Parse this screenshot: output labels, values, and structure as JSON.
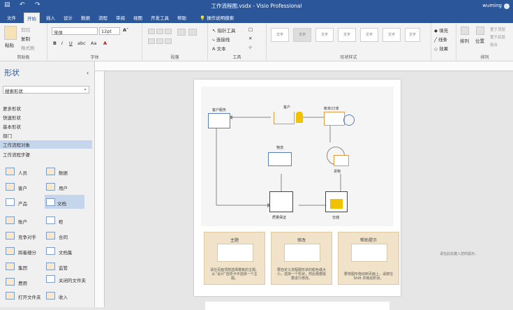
{
  "titlebar": {
    "title": "工作流程图.vsdx - Visio Professional",
    "user": "wuming"
  },
  "tabs": [
    "文件",
    "开始",
    "插入",
    "设计",
    "数据",
    "流程",
    "审阅",
    "视图",
    "开发工具",
    "帮助",
    "操作说明搜索"
  ],
  "ribbon": {
    "clipboard": {
      "paste": "粘贴",
      "cut": "剪切",
      "copy": "复制",
      "painter": "格式刷",
      "label": "剪贴板"
    },
    "font": {
      "family": "宋体",
      "size": "12pt",
      "label": "字体"
    },
    "paragraph": {
      "label": "段落"
    },
    "tools": {
      "pointer": "指针工具",
      "connector": "连接线",
      "text": "文本",
      "label": "工具"
    },
    "styles": {
      "sample": "文字",
      "label": "形状样式"
    },
    "shape_fill": {
      "fill": "填充",
      "line": "线条",
      "effects": "效果"
    },
    "arrange": {
      "arrange": "排列",
      "position": "位置",
      "front": "置于顶层",
      "back": "置于底层",
      "group": "组合",
      "label": "排列"
    }
  },
  "sidebar": {
    "title": "形状",
    "search_placeholder": "搜索形状",
    "items": [
      "更多形状",
      "快速形状",
      "基本形状",
      "部门",
      "工作流程对象",
      "工作流程步骤"
    ],
    "selected": "工作流程对象",
    "shapes": [
      [
        "人员",
        "数据"
      ],
      [
        "客户",
        "用户"
      ],
      [
        "产品",
        "文档"
      ],
      [
        "账户",
        "柜"
      ],
      [
        "竞争对手",
        "合同"
      ],
      [
        "跨着细分",
        "文档集"
      ],
      [
        "集团",
        "监管"
      ],
      [
        "费用",
        "关闭的文件夹"
      ],
      [
        "打开文件夹",
        "收入"
      ]
    ]
  },
  "diagram": {
    "nodes": [
      "客户服务",
      "客户",
      "帐单/订单",
      "物流",
      "货物",
      "质量保证",
      "仓储"
    ],
    "cards": [
      {
        "title": "主题",
        "desc": "请在页面顶部选择模板的主题。从“设计”选项卡中选择一个主题。"
      },
      {
        "title": "修改",
        "desc": "要自定义流程图形状的颜色或大小，选择一个形状，然后根据需要进行修改。"
      },
      {
        "title": "帮助提示",
        "desc": "要将图形拖动到页面上，请按住 Shift 并拖动形状。"
      }
    ],
    "note": "请在此处键入您的提示。"
  },
  "colors": {
    "accent": "#2b579a",
    "node_blue": "#5a7fb5",
    "node_orange": "#e49a45",
    "node_yellow": "#f2c200"
  }
}
